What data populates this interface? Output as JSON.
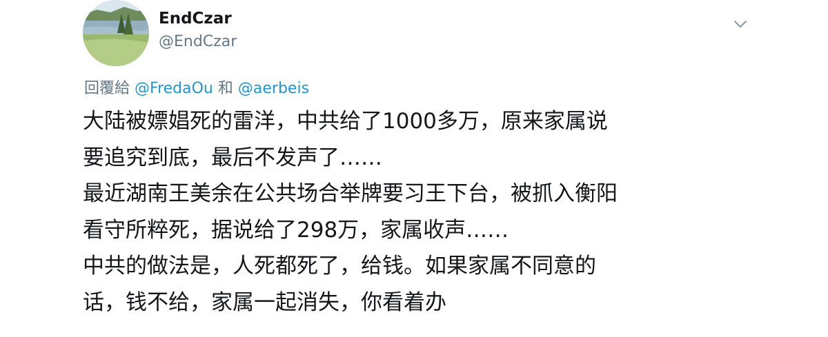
{
  "tweet": {
    "display_name": "EndCzar",
    "handle": "@EndCzar",
    "reply": {
      "prefix": "回覆給",
      "mention_1": "@FredaOu",
      "connector": "和",
      "mention_2": "@aerbeis"
    },
    "lines": [
      "大陆被嫖娼死的雷洋，中共给了1000多万，原来家属说",
      "要追究到底，最后不发声了……",
      "最近湖南王美余在公共场合举牌要习王下台，被抓入衡阳",
      "看守所粹死，据说给了298万，家属收声……",
      "中共的做法是，人死都死了，给钱。如果家属不同意的",
      "话，钱不给，家属一起消失，你看着办"
    ],
    "icons": {
      "menu": "chevron-down-icon",
      "avatar": "avatar-landscape"
    },
    "colors": {
      "text": "#14171a",
      "secondary": "#657786",
      "link": "#1b95e0"
    }
  }
}
